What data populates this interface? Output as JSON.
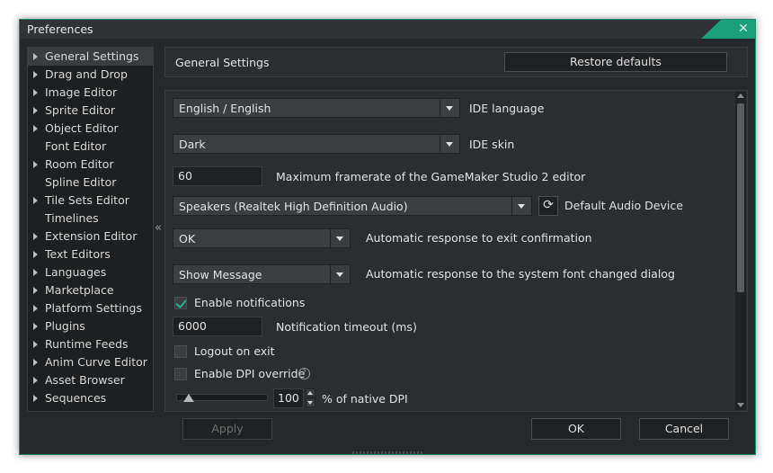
{
  "window": {
    "title": "Preferences",
    "close_icon": "close-icon"
  },
  "sidebar": {
    "items": [
      {
        "label": "General Settings",
        "expandable": true,
        "selected": true
      },
      {
        "label": "Drag and Drop",
        "expandable": true
      },
      {
        "label": "Image Editor",
        "expandable": true
      },
      {
        "label": "Sprite Editor",
        "expandable": true
      },
      {
        "label": "Object Editor",
        "expandable": true
      },
      {
        "label": "Font Editor",
        "expandable": false
      },
      {
        "label": "Room Editor",
        "expandable": true
      },
      {
        "label": "Spline Editor",
        "expandable": false
      },
      {
        "label": "Tile Sets Editor",
        "expandable": true
      },
      {
        "label": "Timelines",
        "expandable": false
      },
      {
        "label": "Extension Editor",
        "expandable": true
      },
      {
        "label": "Text Editors",
        "expandable": true
      },
      {
        "label": "Languages",
        "expandable": true
      },
      {
        "label": "Marketplace",
        "expandable": true
      },
      {
        "label": "Platform Settings",
        "expandable": true
      },
      {
        "label": "Plugins",
        "expandable": true
      },
      {
        "label": "Runtime Feeds",
        "expandable": true
      },
      {
        "label": "Anim Curve Editor",
        "expandable": true
      },
      {
        "label": "Asset Browser",
        "expandable": true
      },
      {
        "label": "Sequences",
        "expandable": true
      }
    ],
    "collapse_glyph": "«"
  },
  "header": {
    "title": "General Settings",
    "restore_label": "Restore defaults"
  },
  "settings": {
    "language": {
      "value": "English / English",
      "label": "IDE language"
    },
    "skin": {
      "value": "Dark",
      "label": "IDE skin"
    },
    "framerate": {
      "value": "60",
      "label": "Maximum framerate of the GameMaker Studio 2 editor"
    },
    "audio": {
      "value": "Speakers (Realtek High Definition Audio)",
      "label": "Default Audio Device",
      "refresh_glyph": "⟳"
    },
    "exit_confirm": {
      "value": "OK",
      "label": "Automatic response to exit confirmation"
    },
    "font_changed": {
      "value": "Show Message",
      "label": "Automatic response to the system font changed dialog"
    },
    "notifications": {
      "checked": true,
      "label": "Enable notifications"
    },
    "notification_timeout": {
      "value": "6000",
      "label": "Notification timeout (ms)"
    },
    "logout": {
      "checked": false,
      "label": "Logout on exit"
    },
    "dpi_override": {
      "checked": false,
      "label": "Enable DPI override",
      "help_glyph": "?"
    },
    "dpi": {
      "value": "100",
      "label": "% of native DPI",
      "slider_fraction": 0.08
    }
  },
  "footer": {
    "apply_label": "Apply",
    "ok_label": "OK",
    "cancel_label": "Cancel"
  },
  "colors": {
    "accent": "#1aa07a",
    "background": "#26292b",
    "panel": "#2b2e30"
  }
}
